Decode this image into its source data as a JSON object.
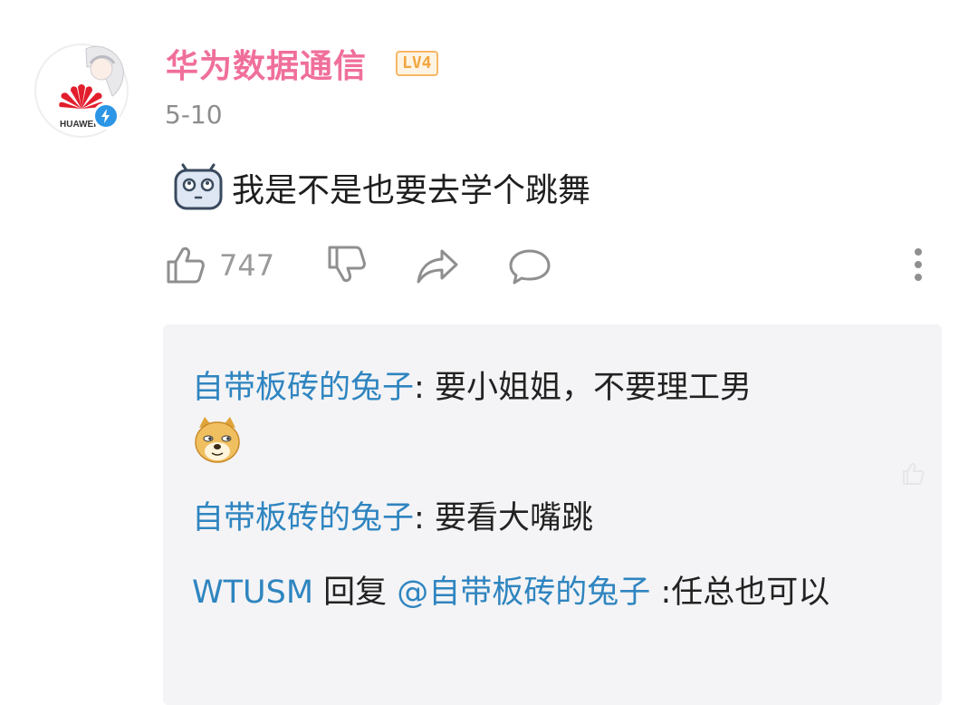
{
  "comment": {
    "username": "华为数据通信",
    "level": "LV4",
    "date": "5-10",
    "avatar": {
      "icon": "huawei-logo-anime-avatar",
      "logo_text": "HUAWEI"
    },
    "emoji": "tv-face-emoji",
    "text": "我是不是也要去学个跳舞",
    "like_count": "747"
  },
  "actions": {
    "like_icon": "thumbs-up-icon",
    "dislike_icon": "thumbs-down-icon",
    "share_icon": "share-icon",
    "comment_icon": "comment-icon",
    "more_icon": "more-vertical-icon"
  },
  "replies": [
    {
      "name": "自带板砖的兔子",
      "separator": ": ",
      "text": "要小姐姐，不要理工男",
      "emoji": "doge-emoji"
    },
    {
      "name": "自带板砖的兔子",
      "separator": ": ",
      "text": "要看大嘴跳"
    },
    {
      "name": "WTUSM",
      "reply_word": " 回复 ",
      "mention": "@自带板砖的兔子",
      "text": " :任总也可以"
    }
  ],
  "colors": {
    "username": "#f06f9a",
    "reply_name": "#2f85c0",
    "reply_bg": "#f4f4f6",
    "meta": "#8d8d8d",
    "verified": "#2c96e6",
    "huawei_red": "#e21d2c"
  }
}
